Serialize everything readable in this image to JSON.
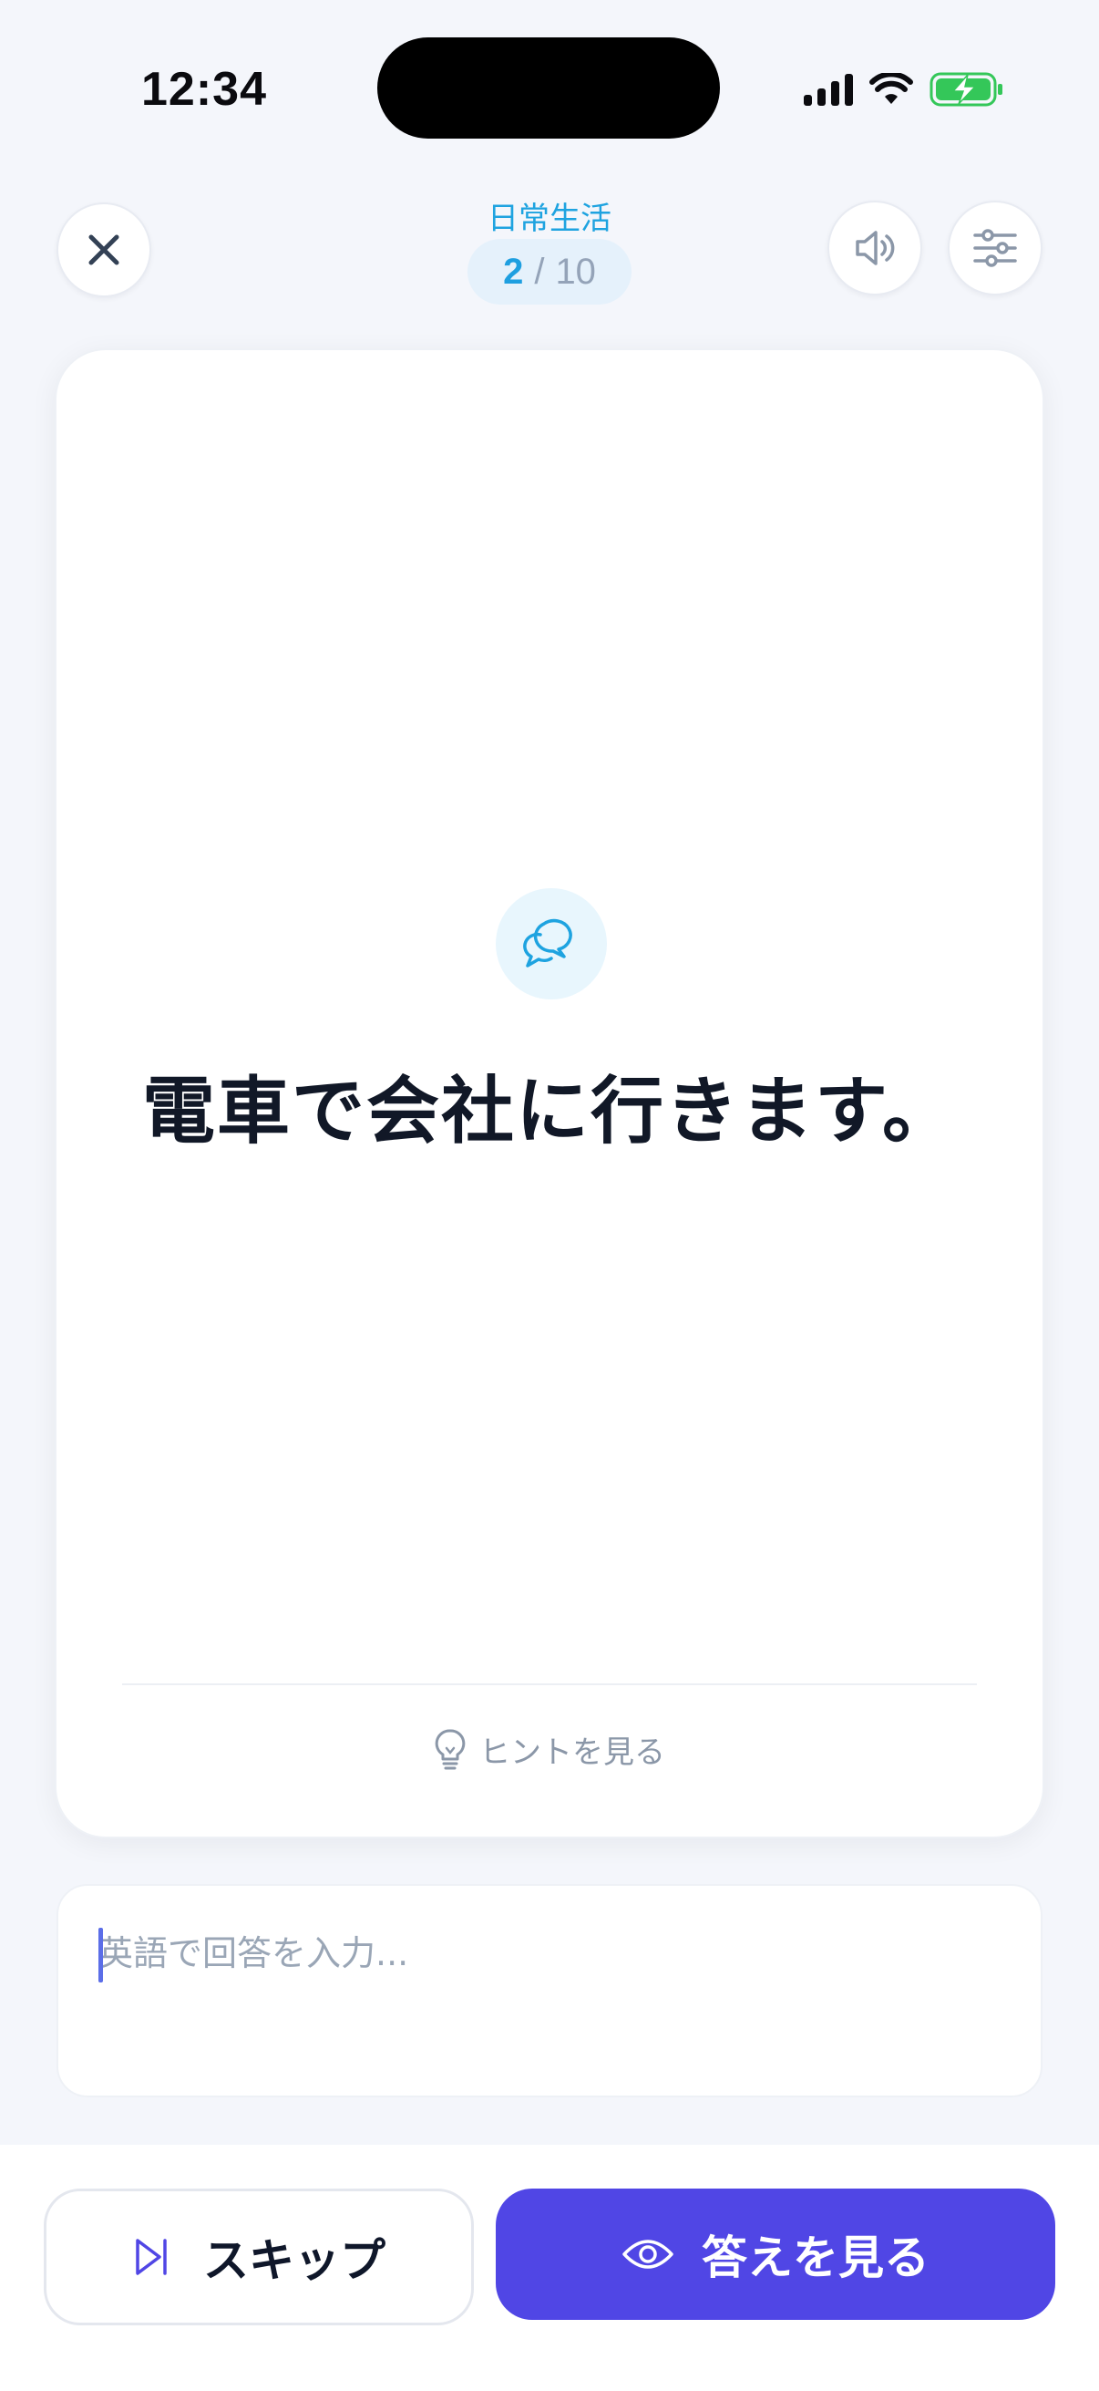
{
  "status_bar": {
    "time": "12:34"
  },
  "header": {
    "category": "日常生活",
    "progress": {
      "current": "2",
      "separator": "/",
      "total": "10"
    },
    "icons": {
      "close": "close-icon",
      "sound": "speaker-icon",
      "settings": "sliders-icon"
    }
  },
  "card": {
    "icon": "chat-bubbles-icon",
    "prompt": "電車で会社に行きます。",
    "hint_label": "ヒントを見る",
    "hint_icon": "lightbulb-icon"
  },
  "answer": {
    "value": "",
    "placeholder": "英語で回答を入力..."
  },
  "actions": {
    "skip_label": "スキップ",
    "skip_icon": "skip-forward-icon",
    "reveal_label": "答えを見る",
    "reveal_icon": "eye-icon"
  },
  "colors": {
    "accent": "#5046e5",
    "category": "#1ea3e0",
    "battery": "#34c759"
  }
}
